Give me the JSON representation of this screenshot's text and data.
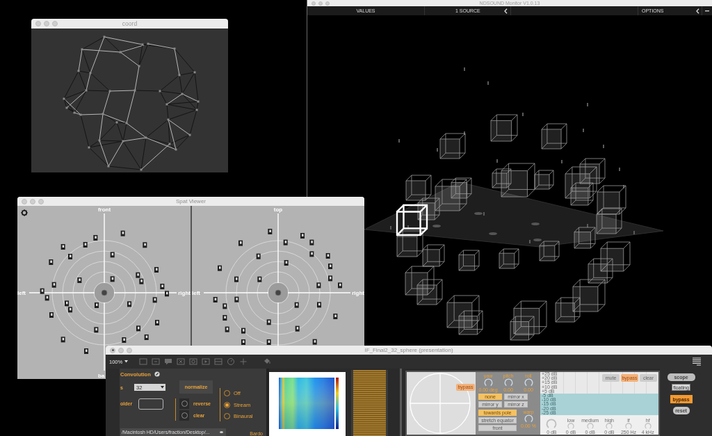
{
  "monitor": {
    "title": "NDSOUND Monitor V1.0.13",
    "toolbar": [
      {
        "kind": "label",
        "label": "VALUES"
      },
      {
        "kind": "collapsible",
        "label": "1 SOURCE"
      },
      {
        "kind": "spacer"
      },
      {
        "kind": "collapsible",
        "label": "OPTIONS"
      },
      {
        "kind": "minimize"
      }
    ]
  },
  "coord": {
    "title": "coord"
  },
  "spat_viewer": {
    "title": "Spat Viewer",
    "views": [
      {
        "top": "front",
        "left": "left",
        "right": "right",
        "bottom": "ba"
      },
      {
        "top": "top",
        "left": "left",
        "right": "right"
      }
    ]
  },
  "patcher": {
    "title": "IF_Final2_32_sphere (presentation)",
    "zoom": "100%",
    "convolution": {
      "title": "Convolution",
      "sources_label": "s",
      "sources_value": "32",
      "folder_label": "older",
      "normalize": "normalize",
      "toggles": [
        {
          "label": "reverse",
          "on": false
        },
        {
          "label": "clear",
          "on": false
        }
      ],
      "modes": [
        {
          "label": "Off",
          "selected": false
        },
        {
          "label": "Stream",
          "selected": true
        },
        {
          "label": "Binaural",
          "selected": false
        }
      ],
      "path": "/Macintosh HD/Users/fraction/Desktop/...",
      "footer": "Bardo"
    },
    "rotation": {
      "bypass": {
        "label": "bypass",
        "on": true
      },
      "knobs": [
        {
          "label": "yaw",
          "value": "0.00 deg"
        },
        {
          "label": "pitch",
          "value": "0.00"
        },
        {
          "label": "roll",
          "value": "0.00"
        }
      ],
      "mirror": [
        {
          "label": "none",
          "selected": true
        },
        {
          "label": "mirror x",
          "selected": false
        },
        {
          "label": "mirror y",
          "selected": false
        },
        {
          "label": "mirror z",
          "selected": false
        }
      ],
      "warp_modes": [
        {
          "label": "towards pole",
          "selected": true
        },
        {
          "label": "stretch equator",
          "selected": false
        },
        {
          "label": "front",
          "selected": false
        }
      ],
      "warp": {
        "label": "warp",
        "value": "0.00 %"
      }
    },
    "eq": {
      "scale_top": [
        "+25 dB",
        "+20 dB",
        "+15 dB",
        "+10 dB",
        "+5 dB"
      ],
      "buttons": [
        {
          "label": "mute",
          "on": false
        },
        {
          "label": "bypass",
          "on": true
        },
        {
          "label": "clear",
          "on": false
        }
      ],
      "scale_bottom": [
        "-5 dB",
        "-10 dB",
        "-15 dB",
        "-20 dB",
        "-25 dB"
      ],
      "knobs": [
        {
          "value": "0 dB"
        },
        {
          "label": "low",
          "value": "0 dB"
        },
        {
          "label": "medium",
          "value": "0 dB"
        },
        {
          "label": "high",
          "value": "0 dB"
        },
        {
          "label": "lf",
          "value": "250 Hz"
        },
        {
          "label": "hf",
          "value": "4 kHz"
        }
      ]
    },
    "output": {
      "scope": "scope",
      "floating": "floating",
      "bypass": {
        "label": "bypass",
        "on": true
      },
      "reset": "reset"
    }
  }
}
